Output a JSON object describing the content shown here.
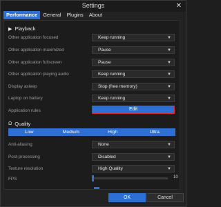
{
  "window": {
    "title": "Settings",
    "close": "✕"
  },
  "tabs": [
    "Performance",
    "General",
    "Plugins",
    "About"
  ],
  "playback": {
    "heading": "Playback",
    "icon": "play-icon",
    "rows": [
      {
        "label": "Other application focused",
        "value": "Keep running"
      },
      {
        "label": "Other application maximized",
        "value": "Pause"
      },
      {
        "label": "Other application fullscreen",
        "value": "Pause"
      },
      {
        "label": "Other application playing audio",
        "value": "Keep running"
      },
      {
        "label": "Display asleep",
        "value": "Stop (free memory)"
      },
      {
        "label": "Laptop on battery",
        "value": "Keep running"
      }
    ],
    "rules_label": "Application rules",
    "edit_label": "Edit"
  },
  "quality": {
    "heading": "Quality",
    "icon": "gauge-icon",
    "options": [
      "Low",
      "Medium",
      "High",
      "Ultra"
    ],
    "rows": [
      {
        "label": "Anti-aliasing",
        "value": "None"
      },
      {
        "label": "Post-processing",
        "value": "Disabled"
      },
      {
        "label": "Texture resolution",
        "value": "High Quality"
      }
    ],
    "fps_label": "FPS",
    "fps_value": "10"
  },
  "footer": {
    "ok": "OK",
    "cancel": "Cancel"
  },
  "colors": {
    "accent": "#2d6fd3",
    "highlight_border": "#e02424",
    "background": "#1c1c1c"
  }
}
